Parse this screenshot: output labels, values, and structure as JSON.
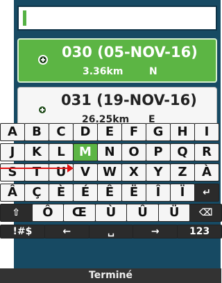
{
  "search": {
    "value": ""
  },
  "results": [
    {
      "title": "030 (05-NOV-16)",
      "distance": "3.36km",
      "direction": "N",
      "selected": true
    },
    {
      "title": "031 (19-NOV-16)",
      "distance": "26.25km",
      "direction": "E",
      "selected": false
    }
  ],
  "keyboard": {
    "rows": [
      [
        "A",
        "B",
        "C",
        "D",
        "E",
        "F",
        "G",
        "H",
        "I"
      ],
      [
        "J",
        "K",
        "L",
        "M",
        "N",
        "O",
        "P",
        "Q",
        "R"
      ],
      [
        "S",
        "T",
        "U",
        "V",
        "W",
        "X",
        "Y",
        "Z",
        "À"
      ],
      [
        "Â",
        "Ç",
        "È",
        "É",
        "Ê",
        "Ë",
        "Î",
        "Ï",
        "↵"
      ],
      [
        "⇧",
        "Ô",
        "Œ",
        "Ù",
        "Û",
        "Ü",
        "⌫"
      ],
      [
        "!#$",
        "←",
        "␣",
        "→",
        "123"
      ]
    ],
    "highlighted_key": "M",
    "done_label": "Terminé"
  },
  "colors": {
    "accent": "#5cb544",
    "header_bg": "#174a63",
    "pointer": "#e01010"
  },
  "icons": {
    "waypoint": "waypoint-icon",
    "enter": "enter-icon",
    "shift": "shift-icon",
    "backspace": "backspace-icon",
    "space": "space-icon"
  }
}
